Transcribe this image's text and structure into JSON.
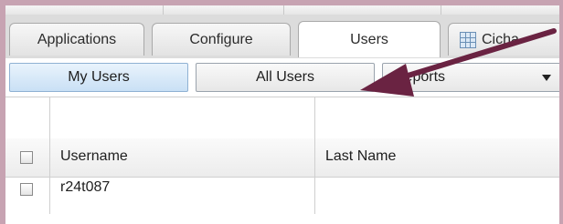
{
  "tabs": [
    {
      "label": "Applications",
      "active": false
    },
    {
      "label": "Configure",
      "active": false
    },
    {
      "label": "Users",
      "active": true
    },
    {
      "label": "Cicha",
      "active": false,
      "icon": "grid-icon"
    }
  ],
  "subnav": {
    "my_users": "My Users",
    "all_users": "All Users",
    "reports": "Reports",
    "reports_icon": "chevron-down-icon"
  },
  "table": {
    "columns": [
      "Username",
      "Last Name"
    ],
    "rows": [
      {
        "username": "r24t087",
        "last_name": ""
      }
    ]
  },
  "colors": {
    "frame": "#c7a3b2",
    "arrow": "#6a2342",
    "active_button": "#c9e0f5"
  }
}
